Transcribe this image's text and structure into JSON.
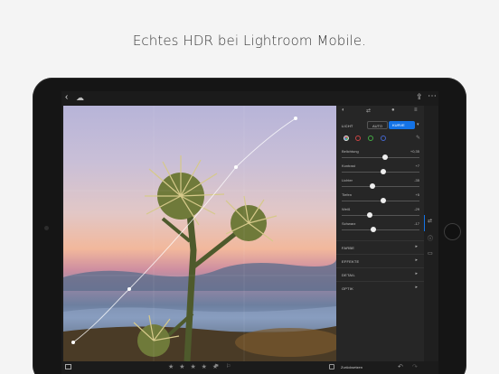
{
  "headline": "Echtes HDR bei Lightroom Mobile.",
  "topbar": {
    "back_icon": "chevron-left",
    "cloud_icon": "cloud-sync",
    "share_icon": "share",
    "more_icon": "more-dots"
  },
  "panel": {
    "tabs": [
      "light-icon",
      "adjust-icon",
      "color-icon",
      "presets-icon"
    ],
    "section_label": "LICHT",
    "auto_label": "AUTO",
    "curve_label": "KURVE",
    "channels": [
      "rgb",
      "red",
      "green",
      "blue"
    ],
    "sliders": [
      {
        "label": "Belichtung",
        "value": "+0,35",
        "pos": 0.56
      },
      {
        "label": "Kontrast",
        "value": "+7",
        "pos": 0.54
      },
      {
        "label": "Lichter",
        "value": "-35",
        "pos": 0.4
      },
      {
        "label": "Tiefen",
        "value": "+5",
        "pos": 0.53
      },
      {
        "label": "Weiß",
        "value": "-29",
        "pos": 0.36
      },
      {
        "label": "Schwarz",
        "value": "-17",
        "pos": 0.41
      }
    ],
    "sections": [
      "FARBE",
      "EFFEKTE",
      "DETAIL",
      "OPTIK"
    ]
  },
  "bottombar": {
    "stars": "★ ★ ★ ★ ★",
    "flags": "⚑ ⚐",
    "reset_label": "Zurücksetzen"
  },
  "colors": {
    "accent": "#1473e6",
    "panel": "#262626"
  }
}
